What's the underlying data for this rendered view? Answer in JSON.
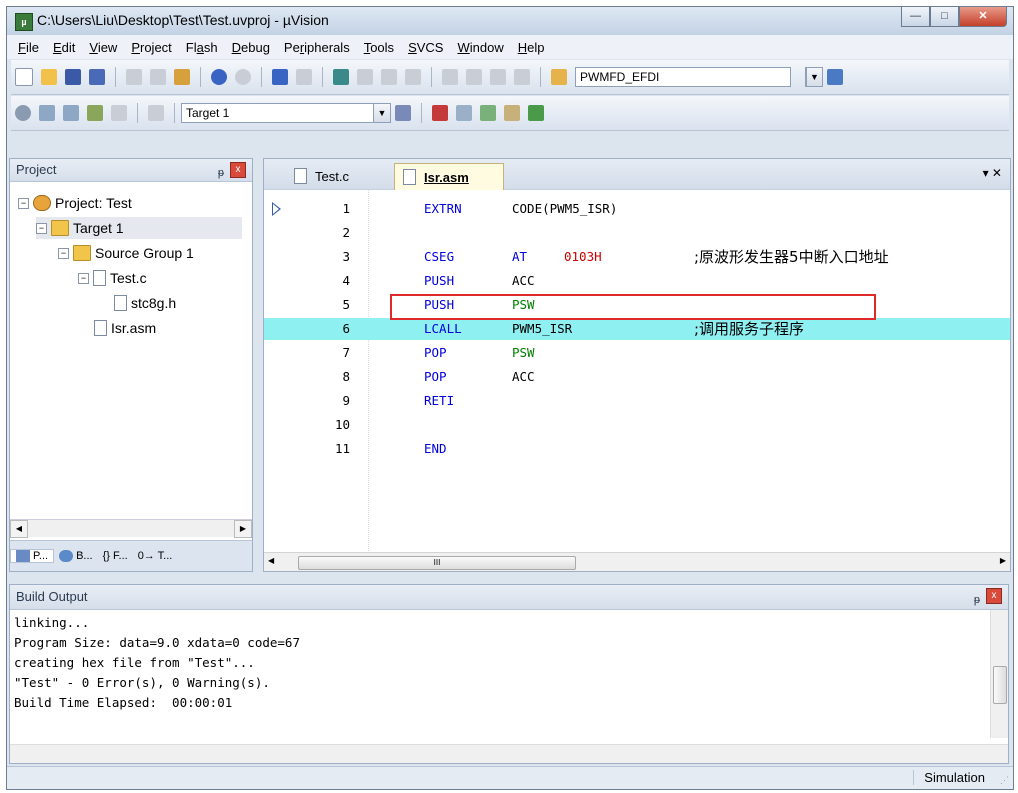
{
  "window": {
    "title": "C:\\Users\\Liu\\Desktop\\Test\\Test.uvproj - µVision",
    "min_glyph": "—",
    "max_glyph": "□",
    "close_glyph": "✕"
  },
  "menu": [
    {
      "pre": "",
      "key": "F",
      "post": "ile"
    },
    {
      "pre": "",
      "key": "E",
      "post": "dit"
    },
    {
      "pre": "",
      "key": "V",
      "post": "iew"
    },
    {
      "pre": "",
      "key": "P",
      "post": "roject"
    },
    {
      "pre": "Fl",
      "key": "a",
      "post": "sh"
    },
    {
      "pre": "",
      "key": "D",
      "post": "ebug"
    },
    {
      "pre": "Pe",
      "key": "r",
      "post": "ipherals"
    },
    {
      "pre": "",
      "key": "T",
      "post": "ools"
    },
    {
      "pre": "",
      "key": "S",
      "post": "VCS"
    },
    {
      "pre": "",
      "key": "W",
      "post": "indow"
    },
    {
      "pre": "",
      "key": "H",
      "post": "elp"
    }
  ],
  "toolbar": {
    "find_combo_value": "PWMFD_EFDI",
    "target_combo_value": "Target 1",
    "combo_arrow": "▼"
  },
  "project_panel": {
    "title": "Project",
    "pin_glyph": "ᵽ",
    "close_glyph": "x",
    "tree": [
      {
        "label": "Project: Test",
        "expander": "−"
      },
      {
        "label": "Target 1",
        "expander": "−"
      },
      {
        "label": "Source Group 1",
        "expander": "−"
      },
      {
        "label": "Test.c",
        "expander": "−"
      },
      {
        "label": "stc8g.h",
        "expander": ""
      },
      {
        "label": "Isr.asm",
        "expander": ""
      }
    ],
    "tabs": [
      {
        "label": "P..."
      },
      {
        "label": "B..."
      },
      {
        "label": "{} F..."
      },
      {
        "label": "0→ T..."
      }
    ],
    "scroll_left": "◀",
    "scroll_right": "▶"
  },
  "editor": {
    "tabs": [
      {
        "label": "Test.c"
      },
      {
        "label": "Isr.asm"
      }
    ],
    "tab_controls": "▾  ✕",
    "lines": [
      {
        "num": "1",
        "kw": "EXTRN",
        "op": "CODE(PWM5_ISR)",
        "op_color": "black",
        "op2": "",
        "comment": ""
      },
      {
        "num": "2",
        "kw": "",
        "op": "",
        "op_color": "black",
        "op2": "",
        "comment": ""
      },
      {
        "num": "3",
        "kw": "CSEG",
        "op": "AT",
        "op_color": "blue",
        "op2": "0103H",
        "comment": ";原波形发生器5中断入口地址"
      },
      {
        "num": "4",
        "kw": "PUSH",
        "op": "ACC",
        "op_color": "black",
        "op2": "",
        "comment": ""
      },
      {
        "num": "5",
        "kw": "PUSH",
        "op": "PSW",
        "op_color": "green",
        "op2": "",
        "comment": ""
      },
      {
        "num": "6",
        "kw": "LCALL",
        "op": "PWM5_ISR",
        "op_color": "black",
        "op2": "",
        "comment": ";调用服务子程序"
      },
      {
        "num": "7",
        "kw": "POP",
        "op": "PSW",
        "op_color": "green",
        "op2": "",
        "comment": ""
      },
      {
        "num": "8",
        "kw": "POP",
        "op": "ACC",
        "op_color": "black",
        "op2": "",
        "comment": ""
      },
      {
        "num": "9",
        "kw": "RETI",
        "op": "",
        "op_color": "black",
        "op2": "",
        "comment": ""
      },
      {
        "num": "10",
        "kw": "",
        "op": "",
        "op_color": "black",
        "op2": "",
        "comment": ""
      },
      {
        "num": "11",
        "kw": "END",
        "op": "",
        "op_color": "black",
        "op2": "",
        "comment": ""
      }
    ],
    "highlighted_line": 6,
    "hscroll_thumb": "III",
    "scroll_left": "◀",
    "scroll_right": "▶"
  },
  "build_output": {
    "title": "Build Output",
    "pin_glyph": "ᵽ",
    "close_glyph": "x",
    "lines": [
      "linking...",
      "Program Size: data=9.0 xdata=0 code=67",
      "creating hex file from \"Test\"...",
      "\"Test\" - 0 Error(s), 0 Warning(s).",
      "Build Time Elapsed:  00:00:01"
    ]
  },
  "statusbar": {
    "mode": "Simulation"
  },
  "colors": {
    "keyword": "#0000e0",
    "register": "#008000",
    "address": "#cc0000",
    "highlight": "#8ff0f2",
    "callout": "#e02a2a"
  }
}
